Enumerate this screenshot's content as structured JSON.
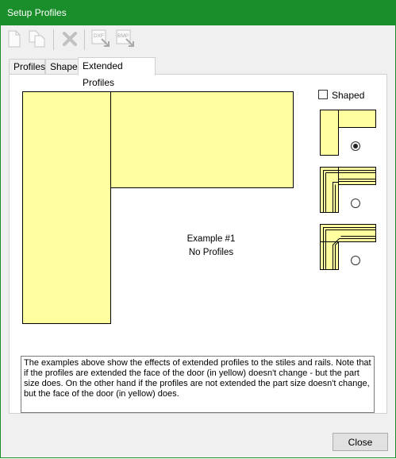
{
  "window": {
    "title": "Setup Profiles"
  },
  "toolbar": {
    "buttons": [
      {
        "name": "new-icon"
      },
      {
        "name": "copy-icon"
      },
      {
        "name": "delete-icon"
      },
      {
        "name": "dxf-import-icon",
        "label": "DXF"
      },
      {
        "name": "bmp-import-icon",
        "label": "BMP"
      }
    ]
  },
  "tabs": [
    {
      "label": "Profiles"
    },
    {
      "label": "Shape"
    },
    {
      "label": "Extended Profiles",
      "active": true
    }
  ],
  "extended_profiles": {
    "shaped_label": "Shaped",
    "shaped_checked": false,
    "example_title": "Example #1",
    "example_subtitle": "No Profiles",
    "selected_option": 1,
    "description": "The examples above show the effects of extended profiles to the stiles and rails.  Note that if the profiles are extended the face of the door (in yellow) doesn't change - but the part size does.  On the other hand if the profiles are not extended the part size doesn't change, but the face of the door (in yellow) does."
  },
  "footer": {
    "close_label": "Close"
  },
  "colors": {
    "titlebar": "#1a8e2a",
    "door_face": "#ffffa0"
  }
}
